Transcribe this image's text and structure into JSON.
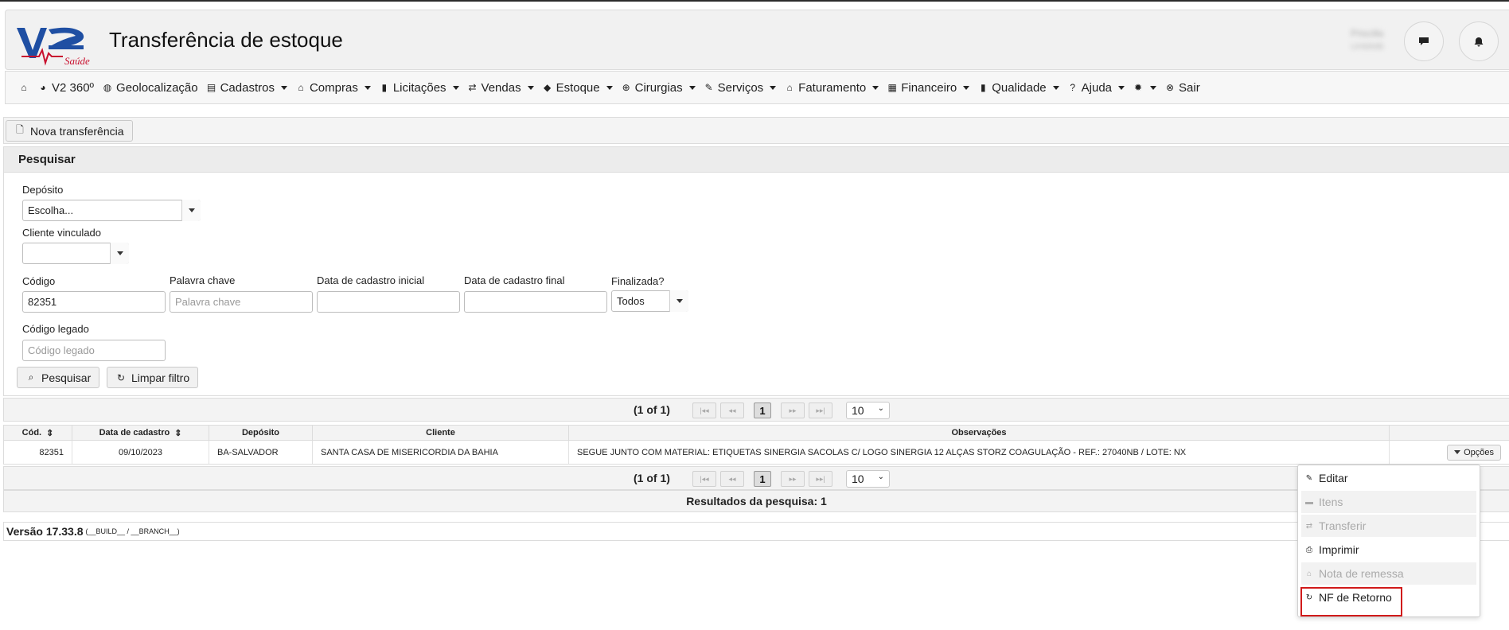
{
  "header": {
    "title": "Transferência de estoque",
    "logo_text": "V2 Saúde",
    "user_name": "Priscilla",
    "user_sub": "UHMMB",
    "chat_icon": "chat-icon",
    "bell_icon": "bell-icon"
  },
  "menu": {
    "items": [
      {
        "label": "",
        "icon": "home-icon",
        "caret": false
      },
      {
        "label": "V2 360º",
        "icon": "pie-chart-icon",
        "caret": false
      },
      {
        "label": "Geolocalização",
        "icon": "globe-icon",
        "caret": false
      },
      {
        "label": "Cadastros",
        "icon": "card-icon",
        "caret": true
      },
      {
        "label": "Compras",
        "icon": "bag-icon",
        "caret": true
      },
      {
        "label": "Licitações",
        "icon": "book-icon",
        "caret": true
      },
      {
        "label": "Vendas",
        "icon": "arrows-icon",
        "caret": true
      },
      {
        "label": "Estoque",
        "icon": "tag-icon",
        "caret": true
      },
      {
        "label": "Cirurgias",
        "icon": "plus-circle-icon",
        "caret": true
      },
      {
        "label": "Serviços",
        "icon": "wrench-icon",
        "caret": true
      },
      {
        "label": "Faturamento",
        "icon": "bag-icon",
        "caret": true
      },
      {
        "label": "Financeiro",
        "icon": "calculator-icon",
        "caret": true
      },
      {
        "label": "Qualidade",
        "icon": "book-icon",
        "caret": true
      },
      {
        "label": "Ajuda",
        "icon": "question-icon",
        "caret": true
      },
      {
        "label": "",
        "icon": "gear-icon",
        "caret": true
      },
      {
        "label": "Sair",
        "icon": "close-circle-icon",
        "caret": false
      }
    ]
  },
  "toolbar": {
    "new_label": "Nova transferência"
  },
  "search": {
    "title": "Pesquisar",
    "deposito_label": "Depósito",
    "deposito_value": "Escolha...",
    "cliente_label": "Cliente vinculado",
    "cliente_value": "",
    "codigo_label": "Código",
    "codigo_value": "82351",
    "palavra_label": "Palavra chave",
    "palavra_placeholder": "Palavra chave",
    "data_ini_label": "Data de cadastro inicial",
    "data_fim_label": "Data de cadastro final",
    "finalizada_label": "Finalizada?",
    "finalizada_value": "Todos",
    "legado_label": "Código legado",
    "legado_placeholder": "Código legado",
    "search_button": "Pesquisar",
    "clear_button": "Limpar filtro"
  },
  "pagination": {
    "summary": "(1 of 1)",
    "current_page": "1",
    "rows_per_page": "10"
  },
  "table": {
    "headers": [
      "Cód.",
      "Data de cadastro",
      "Depósito",
      "Cliente",
      "Observações",
      ""
    ],
    "rows": [
      {
        "codigo": "82351",
        "data": "09/10/2023",
        "deposito": "BA-SALVADOR",
        "cliente": "SANTA CASA DE MISERICORDIA DA BAHIA",
        "observacoes": "SEGUE JUNTO COM MATERIAL: ETIQUETAS SINERGIA SACOLAS C/ LOGO SINERGIA 12 ALÇAS STORZ COAGULAÇÃO - REF.: 27040NB / LOTE: NX",
        "options_label": "Opções"
      }
    ]
  },
  "results_label": "Resultados da pesquisa: 1",
  "version": {
    "label": "Versão 17.33.8",
    "build": "(__BUILD__ / __BRANCH__)"
  },
  "options_menu": {
    "items": [
      {
        "label": "Editar",
        "icon": "pencil-icon",
        "disabled": false
      },
      {
        "label": "Itens",
        "icon": "list-icon",
        "disabled": true
      },
      {
        "label": "Transferir",
        "icon": "transfer-icon",
        "disabled": true
      },
      {
        "label": "Imprimir",
        "icon": "print-icon",
        "disabled": false
      },
      {
        "label": "Nota de remessa",
        "icon": "bag-icon",
        "disabled": true
      },
      {
        "label": "NF de Retorno",
        "icon": "refresh-icon",
        "disabled": false
      }
    ]
  }
}
